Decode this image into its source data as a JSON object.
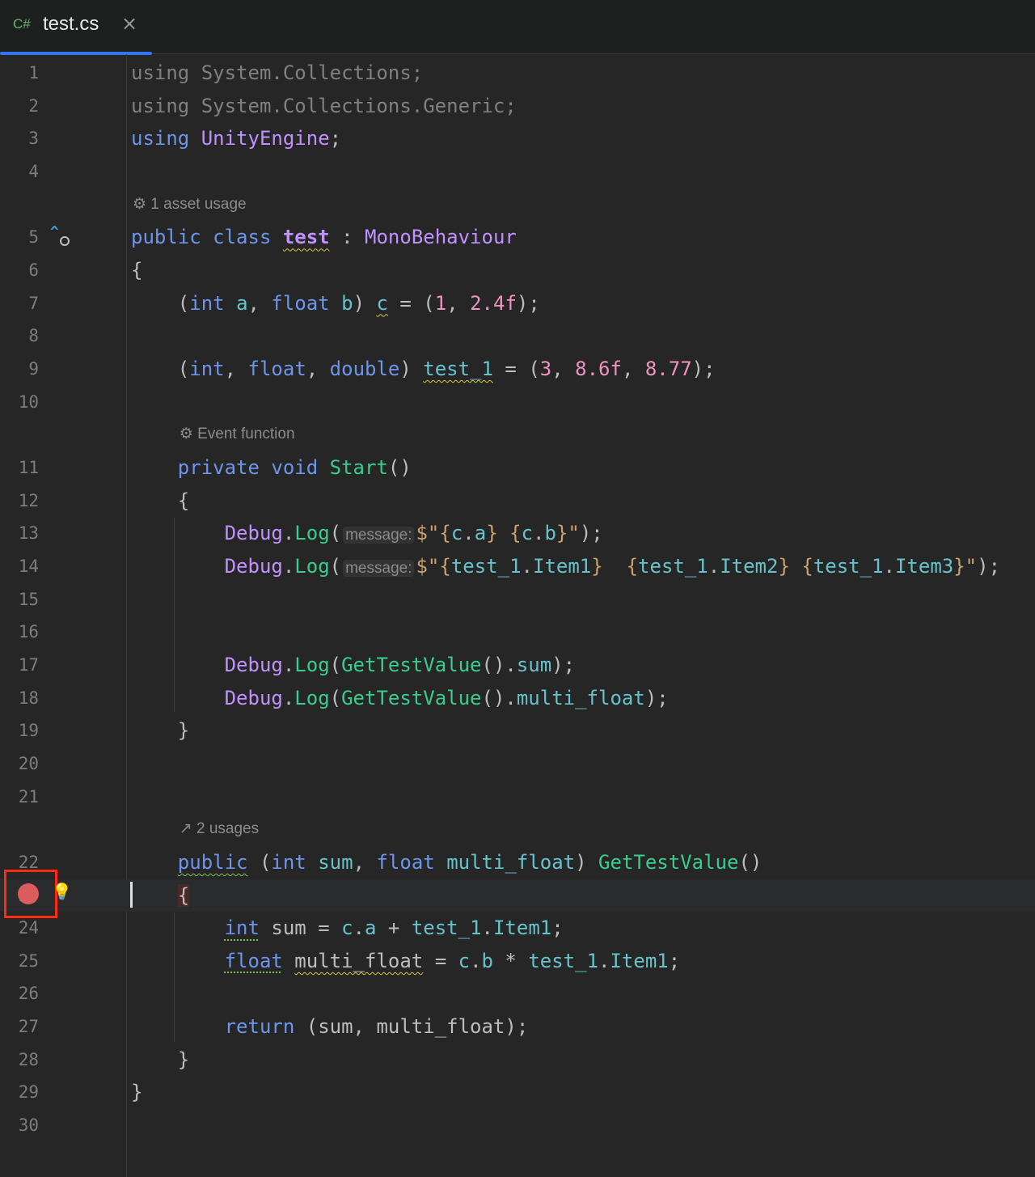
{
  "tab": {
    "lang": "C#",
    "name": "test.cs",
    "close": "×"
  },
  "colors": {
    "keyword": "#6c95eb",
    "type": "#c191ff",
    "method": "#39cc8f",
    "number": "#ed94c0",
    "field": "#66c3cc",
    "string": "#c9a26d",
    "breakpoint": "#db5c5c",
    "highlight_box": "#ff2a12",
    "accent": "#3574f0"
  },
  "breakpoint_line": 23,
  "rows": [
    {
      "ln": "1",
      "tokens": [
        [
          "using System.Collections;",
          "u"
        ]
      ]
    },
    {
      "ln": "2",
      "tokens": [
        [
          "using System.Collections.Generic;",
          "u"
        ]
      ]
    },
    {
      "ln": "3",
      "tokens": [
        [
          "using",
          "k"
        ],
        [
          " ",
          "p"
        ],
        [
          "UnityEngine",
          "t"
        ],
        [
          ";",
          "p"
        ]
      ]
    },
    {
      "ln": "4",
      "tokens": []
    },
    {
      "hint": "⚙ 1 asset usage",
      "indent": 0
    },
    {
      "ln": "5",
      "tokens": [
        [
          "public",
          "k"
        ],
        [
          " ",
          "p"
        ],
        [
          "class",
          "k"
        ],
        [
          " ",
          "p"
        ],
        [
          "test",
          "t b wy"
        ],
        [
          " : ",
          "p"
        ],
        [
          "MonoBehaviour",
          "t"
        ]
      ]
    },
    {
      "ln": "6",
      "tokens": [
        [
          "{",
          "p"
        ]
      ]
    },
    {
      "ln": "7",
      "tokens": [
        [
          "    (",
          "p"
        ],
        [
          "int",
          "k"
        ],
        [
          " ",
          "p"
        ],
        [
          "a",
          "f"
        ],
        [
          ", ",
          "p"
        ],
        [
          "float",
          "k"
        ],
        [
          " ",
          "p"
        ],
        [
          "b",
          "f"
        ],
        [
          ") ",
          "p"
        ],
        [
          "c",
          "f wy"
        ],
        [
          " = (",
          "p"
        ],
        [
          "1",
          "n"
        ],
        [
          ", ",
          "p"
        ],
        [
          "2.4f",
          "n"
        ],
        [
          ");",
          "p"
        ]
      ]
    },
    {
      "ln": "8",
      "tokens": []
    },
    {
      "ln": "9",
      "tokens": [
        [
          "    (",
          "p"
        ],
        [
          "int",
          "k"
        ],
        [
          ", ",
          "p"
        ],
        [
          "float",
          "k"
        ],
        [
          ", ",
          "p"
        ],
        [
          "double",
          "k"
        ],
        [
          ") ",
          "p"
        ],
        [
          "test_1",
          "f wy"
        ],
        [
          " = (",
          "p"
        ],
        [
          "3",
          "n"
        ],
        [
          ", ",
          "p"
        ],
        [
          "8.6f",
          "n"
        ],
        [
          ", ",
          "p"
        ],
        [
          "8.77",
          "n"
        ],
        [
          ");",
          "p"
        ]
      ]
    },
    {
      "ln": "10",
      "tokens": []
    },
    {
      "hint": "⚙ Event function",
      "indent": 4
    },
    {
      "ln": "11",
      "tokens": [
        [
          "    ",
          "p"
        ],
        [
          "private",
          "k"
        ],
        [
          " ",
          "p"
        ],
        [
          "void",
          "k"
        ],
        [
          " ",
          "p"
        ],
        [
          "Start",
          "m"
        ],
        [
          "()",
          "p"
        ]
      ]
    },
    {
      "ln": "12",
      "tokens": [
        [
          "    {",
          "p"
        ]
      ]
    },
    {
      "ln": "13",
      "tokens": [
        [
          "        ",
          "p"
        ],
        [
          "Debug",
          "t"
        ],
        [
          ".",
          "p"
        ],
        [
          "Log",
          "m"
        ],
        [
          "(",
          "p"
        ],
        [
          "message:",
          "pm"
        ],
        [
          "$\"{",
          "s"
        ],
        [
          "c",
          "f"
        ],
        [
          ".",
          "p"
        ],
        [
          "a",
          "f"
        ],
        [
          "} {",
          "s"
        ],
        [
          "c",
          "f"
        ],
        [
          ".",
          "p"
        ],
        [
          "b",
          "f"
        ],
        [
          "}\"",
          "s"
        ],
        [
          ");",
          "p"
        ]
      ]
    },
    {
      "ln": "14",
      "tokens": [
        [
          "        ",
          "p"
        ],
        [
          "Debug",
          "t"
        ],
        [
          ".",
          "p"
        ],
        [
          "Log",
          "m"
        ],
        [
          "(",
          "p"
        ],
        [
          "message:",
          "pm"
        ],
        [
          "$\"{",
          "s"
        ],
        [
          "test_1",
          "f"
        ],
        [
          ".",
          "p"
        ],
        [
          "Item1",
          "f"
        ],
        [
          "}  {",
          "s"
        ],
        [
          "test_1",
          "f"
        ],
        [
          ".",
          "p"
        ],
        [
          "Item2",
          "f"
        ],
        [
          "} {",
          "s"
        ],
        [
          "test_1",
          "f"
        ],
        [
          ".",
          "p"
        ],
        [
          "Item3",
          "f"
        ],
        [
          "}\"",
          "s"
        ],
        [
          ");",
          "p"
        ]
      ]
    },
    {
      "ln": "15",
      "tokens": []
    },
    {
      "ln": "16",
      "tokens": []
    },
    {
      "ln": "17",
      "tokens": [
        [
          "        ",
          "p"
        ],
        [
          "Debug",
          "t"
        ],
        [
          ".",
          "p"
        ],
        [
          "Log",
          "m"
        ],
        [
          "(",
          "p"
        ],
        [
          "GetTestValue",
          "m"
        ],
        [
          "().",
          "p"
        ],
        [
          "sum",
          "f"
        ],
        [
          ");",
          "p"
        ]
      ]
    },
    {
      "ln": "18",
      "tokens": [
        [
          "        ",
          "p"
        ],
        [
          "Debug",
          "t"
        ],
        [
          ".",
          "p"
        ],
        [
          "Log",
          "m"
        ],
        [
          "(",
          "p"
        ],
        [
          "GetTestValue",
          "m"
        ],
        [
          "().",
          "p"
        ],
        [
          "multi_float",
          "f"
        ],
        [
          ");",
          "p"
        ]
      ]
    },
    {
      "ln": "19",
      "tokens": [
        [
          "    }",
          "p"
        ]
      ]
    },
    {
      "ln": "20",
      "tokens": []
    },
    {
      "ln": "21",
      "tokens": []
    },
    {
      "hint": "↗ 2 usages",
      "indent": 4
    },
    {
      "ln": "22",
      "tokens": [
        [
          "    ",
          "p"
        ],
        [
          "public",
          "k wg"
        ],
        [
          " (",
          "p"
        ],
        [
          "int",
          "k"
        ],
        [
          " ",
          "p"
        ],
        [
          "sum",
          "f"
        ],
        [
          ", ",
          "p"
        ],
        [
          "float",
          "k"
        ],
        [
          " ",
          "p"
        ],
        [
          "multi_float",
          "f"
        ],
        [
          ") ",
          "p"
        ],
        [
          "GetTestValue",
          "m"
        ],
        [
          "()",
          "p"
        ]
      ]
    },
    {
      "ln": "23",
      "tokens": [
        [
          "    ",
          "p"
        ],
        [
          "{",
          "p brace-hl"
        ]
      ]
    },
    {
      "ln": "24",
      "tokens": [
        [
          "        ",
          "p"
        ],
        [
          "int",
          "k dg"
        ],
        [
          " sum = ",
          "p"
        ],
        [
          "c",
          "f"
        ],
        [
          ".",
          "p"
        ],
        [
          "a",
          "f"
        ],
        [
          " + ",
          "p"
        ],
        [
          "test_1",
          "f"
        ],
        [
          ".",
          "p"
        ],
        [
          "Item1",
          "f"
        ],
        [
          ";",
          "p"
        ]
      ]
    },
    {
      "ln": "25",
      "tokens": [
        [
          "        ",
          "p"
        ],
        [
          "float",
          "k dg"
        ],
        [
          " ",
          "p"
        ],
        [
          "multi_float",
          "p wy"
        ],
        [
          " = ",
          "p"
        ],
        [
          "c",
          "f"
        ],
        [
          ".",
          "p"
        ],
        [
          "b",
          "f"
        ],
        [
          " * ",
          "p"
        ],
        [
          "test_1",
          "f"
        ],
        [
          ".",
          "p"
        ],
        [
          "Item1",
          "f"
        ],
        [
          ";",
          "p"
        ]
      ]
    },
    {
      "ln": "26",
      "tokens": []
    },
    {
      "ln": "27",
      "tokens": [
        [
          "        ",
          "p"
        ],
        [
          "return",
          "k"
        ],
        [
          " (sum, multi_float);",
          "p"
        ]
      ]
    },
    {
      "ln": "28",
      "tokens": [
        [
          "    }",
          "p"
        ]
      ]
    },
    {
      "ln": "29",
      "tokens": [
        [
          "}",
          "p"
        ]
      ]
    },
    {
      "ln": "30",
      "tokens": []
    }
  ]
}
